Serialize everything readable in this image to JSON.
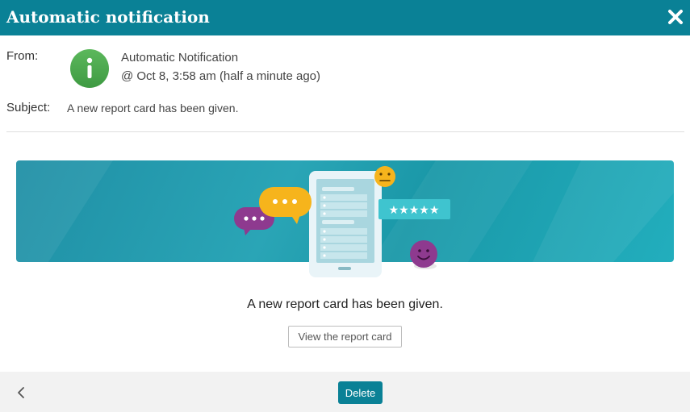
{
  "dialog": {
    "title": "Automatic notification",
    "close_icon": "close-icon"
  },
  "meta": {
    "from_label": "From:",
    "sender_name": "Automatic Notification",
    "sent_time": "@ Oct 8, 3:58 am (half a minute ago)",
    "avatar_icon": "info-icon",
    "subject_label": "Subject:",
    "subject": "A new report card has been given."
  },
  "body": {
    "banner_icon": "report-card-illustration",
    "message": "A new report card has been given.",
    "view_button": "View the report card"
  },
  "footer": {
    "back_icon": "chevron-left-icon",
    "delete_button": "Delete"
  },
  "colors": {
    "header": "#0a8196",
    "avatar": "#4caf50",
    "banner": "#1f9aae",
    "delete_button": "#0a8196"
  }
}
